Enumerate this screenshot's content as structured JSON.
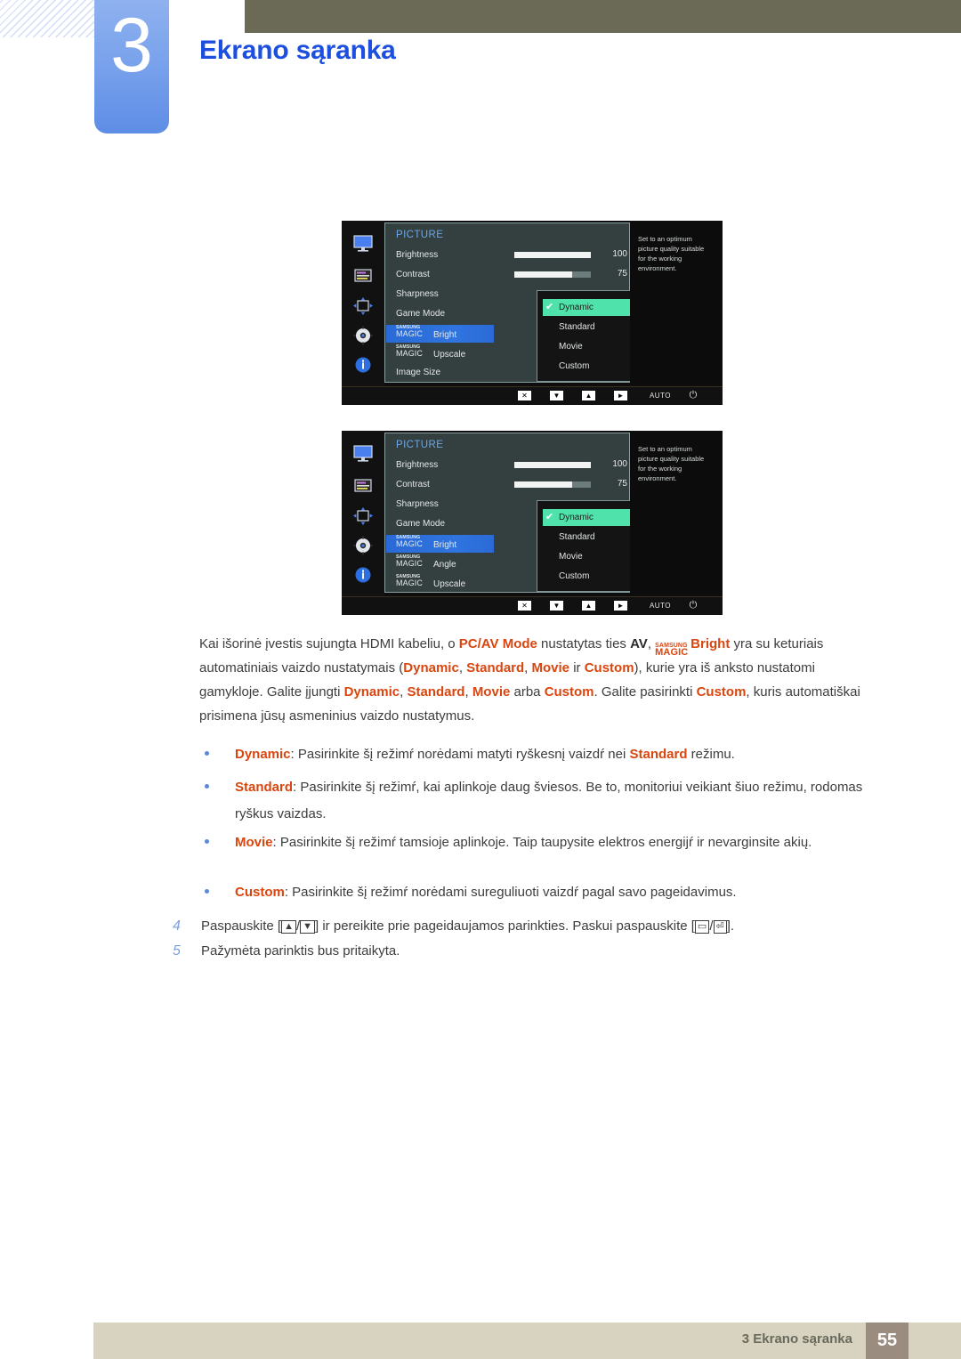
{
  "header": {
    "chapter_number": "3",
    "chapter_title": "Ekrano sąranka"
  },
  "osd_figures": [
    {
      "title": "PICTURE",
      "help_text": "Set to an optimum picture quality suitable for the working environment.",
      "rail_icons": [
        "monitor-icon",
        "onscreen-display-icon",
        "position-icon",
        "setup-gear-icon",
        "information-icon"
      ],
      "rows": [
        {
          "label": "Brightness",
          "value": "100",
          "slider_percent": 100,
          "highlighted": false
        },
        {
          "label": "Contrast",
          "value": "75",
          "slider_percent": 75,
          "highlighted": false
        },
        {
          "label": "Sharpness",
          "value": "",
          "highlighted": false
        },
        {
          "label": "Game Mode",
          "value": "",
          "highlighted": false
        },
        {
          "label_prefix_top": "SAMSUNG",
          "label_prefix_bottom": "MAGIC",
          "label_suffix": "Bright",
          "highlighted": true
        },
        {
          "label_prefix_top": "SAMSUNG",
          "label_prefix_bottom": "MAGIC",
          "label_suffix": "Upscale",
          "highlighted": false
        },
        {
          "label": "Image Size",
          "value": "",
          "highlighted": false
        }
      ],
      "dropdown": {
        "items": [
          "Dynamic",
          "Standard",
          "Movie",
          "Custom"
        ],
        "selected": "Dynamic",
        "check_glyph": "✔"
      },
      "keybar": {
        "keys": [
          "✕",
          "▼",
          "▲",
          "►"
        ],
        "auto_label": "AUTO",
        "power_glyph": "⏻"
      }
    },
    {
      "title": "PICTURE",
      "help_text": "Set to an optimum picture quality suitable for the working environment.",
      "rail_icons": [
        "monitor-icon",
        "onscreen-display-icon",
        "position-icon",
        "setup-gear-icon",
        "information-icon"
      ],
      "rows": [
        {
          "label": "Brightness",
          "value": "100",
          "slider_percent": 100,
          "highlighted": false
        },
        {
          "label": "Contrast",
          "value": "75",
          "slider_percent": 75,
          "highlighted": false
        },
        {
          "label": "Sharpness",
          "value": "",
          "highlighted": false
        },
        {
          "label": "Game Mode",
          "value": "",
          "highlighted": false
        },
        {
          "label_prefix_top": "SAMSUNG",
          "label_prefix_bottom": "MAGIC",
          "label_suffix": "Bright",
          "highlighted": true
        },
        {
          "label_prefix_top": "SAMSUNG",
          "label_prefix_bottom": "MAGIC",
          "label_suffix": "Angle",
          "highlighted": false
        },
        {
          "label_prefix_top": "SAMSUNG",
          "label_prefix_bottom": "MAGIC",
          "label_suffix": "Upscale",
          "highlighted": false
        }
      ],
      "dropdown": {
        "items": [
          "Dynamic",
          "Standard",
          "Movie",
          "Custom"
        ],
        "selected": "Dynamic",
        "check_glyph": "✔"
      },
      "keybar": {
        "keys": [
          "✕",
          "▼",
          "▲",
          "►"
        ],
        "auto_label": "AUTO",
        "power_glyph": "⏻"
      }
    }
  ],
  "body": {
    "paragraph": {
      "t1": "Kai išorinė įvestis sujungta HDMI kabeliu, o ",
      "b1": "PC/AV Mode",
      "t2": " nustatytas ties ",
      "b2": "AV",
      "t3": ", ",
      "magic_top": "SAMSUNG",
      "magic_bottom": "MAGIC",
      "b3": "Bright",
      "t4": " yra su keturiais automatiniais vaizdo nustatymais (",
      "b4": "Dynamic",
      "t5": ", ",
      "b5": "Standard",
      "t6": ", ",
      "b6": "Movie",
      "t7": " ir ",
      "b7": "Custom",
      "t8": "), kurie yra iš anksto nustatomi gamykloje. Galite įjungti ",
      "b8": "Dynamic",
      "t9": ", ",
      "b9": "Standard",
      "t10": ", ",
      "b10": "Movie",
      "t11": " arba ",
      "b11": "Custom",
      "t12": ". Galite pasirinkti ",
      "b12": "Custom",
      "t13": ", kuris automatiškai prisimena jūsų asmeninius vaizdo nustatymus."
    },
    "bullets": [
      {
        "term": "Dynamic",
        "text_before": ": Pasirinkite šį režimŕ norėdami matyti ryškesnį vaizdŕ nei ",
        "term2": "Standard",
        "text_after": " režimu."
      },
      {
        "term": "Standard",
        "text_before": ": Pasirinkite šį režimŕ, kai aplinkoje daug šviesos. Be to, monitoriui veikiant šiuo režimu, rodomas ryškus vaizdas.",
        "term2": "",
        "text_after": ""
      },
      {
        "term": "Movie",
        "text_before": ": Pasirinkite šį režimŕ tamsioje aplinkoje. Taip taupysite elektros energijŕ ir nevarginsite akių.",
        "term2": "",
        "text_after": ""
      },
      {
        "term": "Custom",
        "text_before": ": Pasirinkite šį režimŕ norėdami sureguliuoti vaizdŕ pagal savo pageidavimus.",
        "term2": "",
        "text_after": ""
      }
    ],
    "steps": [
      {
        "number": "4",
        "t1": "Paspauskite [",
        "k1": "▲",
        "k_sep": "/",
        "k2": "▼",
        "t2": "] ir pereikite prie pageidaujamos parinkties. Paskui paspauskite [",
        "k3": "▭",
        "k_sep2": "/",
        "k4": "⏎",
        "t3": "]."
      },
      {
        "number": "5",
        "t1": "Pažymėta parinktis bus pritaikyta.",
        "k1": "",
        "k_sep": "",
        "k2": "",
        "t2": "",
        "k3": "",
        "k_sep2": "",
        "k4": "",
        "t3": ""
      }
    ]
  },
  "footer": {
    "text": "3 Ekrano sąranka",
    "page_number": "55"
  },
  "colors": {
    "olive_bar": "#6b6a56",
    "chapter_tab": "#7aa3ec",
    "title_blue": "#1c4fe0",
    "accent_orange": "#d9460f",
    "osd_panel": "#343f3f",
    "osd_highlight_blue": "#2f74e0",
    "osd_selected_green": "#4fe3ab",
    "footer_band": "#d8d3c0",
    "footer_page_box": "#9a8d80"
  }
}
